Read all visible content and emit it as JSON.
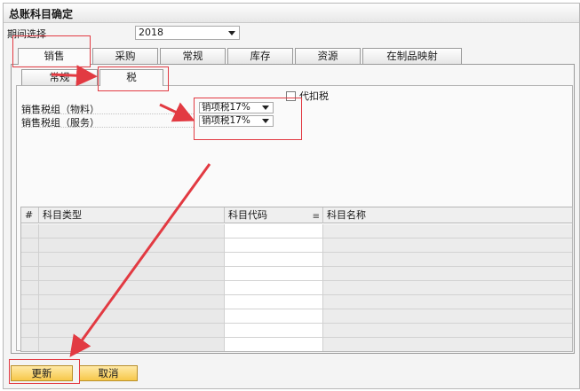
{
  "window": {
    "title": "总账科目确定"
  },
  "period": {
    "label": "期间选择",
    "value": "2018"
  },
  "tabs": [
    {
      "label": "销售"
    },
    {
      "label": "采购"
    },
    {
      "label": "常规"
    },
    {
      "label": "库存"
    },
    {
      "label": "资源"
    },
    {
      "label": "在制品映射"
    }
  ],
  "subtabs": [
    {
      "label": "常规"
    },
    {
      "label": "税"
    }
  ],
  "tax": {
    "withholding_label": "代扣税",
    "groups": [
      {
        "label": "销售税组（物料）",
        "value": "销项税17%"
      },
      {
        "label": "销售税组（服务）",
        "value": "销项税17%"
      }
    ]
  },
  "grid": {
    "columns": [
      "#",
      "科目类型",
      "科目代码",
      "科目名称"
    ]
  },
  "buttons": {
    "update": "更新",
    "cancel": "取消"
  },
  "annotation_color": "#e23a42"
}
